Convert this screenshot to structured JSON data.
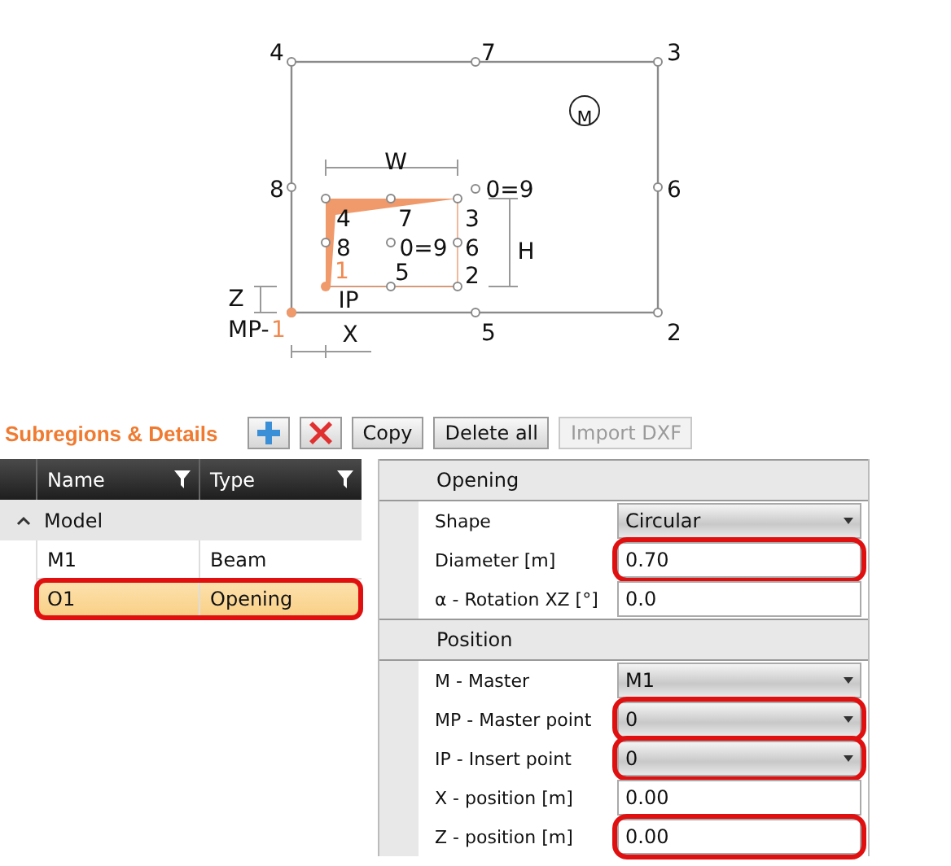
{
  "diagram": {
    "labels": [
      {
        "text": "4",
        "accent": false
      },
      {
        "text": "7",
        "accent": false
      },
      {
        "text": "3",
        "accent": false
      },
      {
        "text": "M",
        "accent": false
      },
      {
        "text": "8",
        "accent": false
      },
      {
        "text": "6",
        "accent": false
      },
      {
        "text": "W",
        "accent": false
      },
      {
        "text": "0=9",
        "accent": false
      },
      {
        "text": "4",
        "accent": false
      },
      {
        "text": "7",
        "accent": false
      },
      {
        "text": "3",
        "accent": false
      },
      {
        "text": "8",
        "accent": false
      },
      {
        "text": "0=9",
        "accent": false
      },
      {
        "text": "6",
        "accent": false
      },
      {
        "text": "H",
        "accent": false
      },
      {
        "text": "1",
        "accent": true
      },
      {
        "text": "5",
        "accent": false
      },
      {
        "text": "2",
        "accent": false
      },
      {
        "text": "Z",
        "accent": false
      },
      {
        "text": "IP",
        "accent": false
      },
      {
        "text": "MP-",
        "accent": false
      },
      {
        "text": "1",
        "accent": true
      },
      {
        "text": "X",
        "accent": false
      },
      {
        "text": "5",
        "accent": false
      },
      {
        "text": "2",
        "accent": false
      }
    ]
  },
  "toolbar": {
    "title": "Subregions & Details",
    "buttons": [
      {
        "kind": "add",
        "disabled": false
      },
      {
        "kind": "delete",
        "disabled": false
      },
      {
        "kind": "text",
        "label": "Copy",
        "disabled": false
      },
      {
        "kind": "text",
        "label": "Delete all",
        "disabled": false
      },
      {
        "kind": "text",
        "label": "Import DXF",
        "disabled": true
      }
    ]
  },
  "table": {
    "columns": [
      "Name",
      "Type"
    ],
    "group": {
      "label": "Model",
      "expanded": true,
      "rows": [
        {
          "name": "M1",
          "type": "Beam",
          "selected": false,
          "highlighted": false
        },
        {
          "name": "O1",
          "type": "Opening",
          "selected": true,
          "highlighted": true
        }
      ]
    }
  },
  "properties": {
    "sections": [
      {
        "title": "Opening",
        "rows": [
          {
            "label": "Shape",
            "kind": "select",
            "value": "Circular",
            "highlighted": false
          },
          {
            "label": "Diameter [m]",
            "kind": "input",
            "value": "0.70",
            "highlighted": true
          },
          {
            "label": "α - Rotation XZ [°]",
            "kind": "input",
            "value": "0.0",
            "highlighted": false
          }
        ]
      },
      {
        "title": "Position",
        "rows": [
          {
            "label": "M - Master",
            "kind": "select",
            "value": "M1",
            "highlighted": false
          },
          {
            "label": "MP - Master point",
            "kind": "select",
            "value": "0",
            "highlighted": true
          },
          {
            "label": "IP - Insert point",
            "kind": "select",
            "value": "0",
            "highlighted": true
          },
          {
            "label": "X - position [m]",
            "kind": "input",
            "value": "0.00",
            "highlighted": false
          },
          {
            "label": "Z - position [m]",
            "kind": "input",
            "value": "0.00",
            "highlighted": true
          }
        ]
      }
    ]
  }
}
